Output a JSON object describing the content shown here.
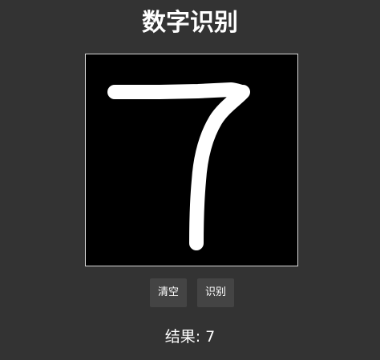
{
  "app": {
    "title": "数字识别"
  },
  "drawing_canvas": {
    "background_color": "#000000",
    "stroke_color": "#ffffff",
    "drawn_digit": "7"
  },
  "buttons": {
    "clear_label": "清空",
    "recognize_label": "识别"
  },
  "result": {
    "label": "结果: ",
    "value": "7"
  },
  "colors": {
    "page_background": "#333333",
    "button_background": "#444444",
    "text": "#ffffff"
  }
}
